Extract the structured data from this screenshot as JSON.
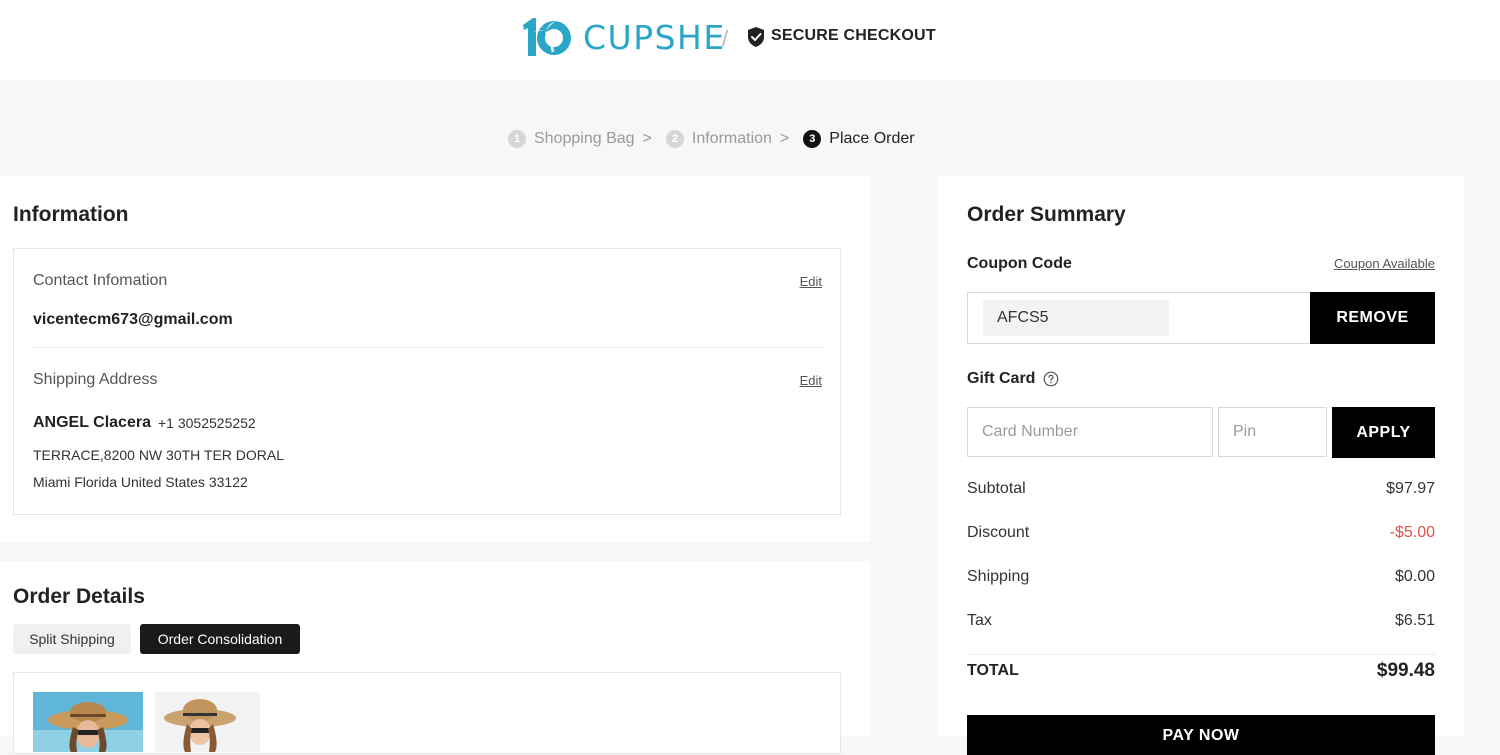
{
  "header": {
    "brand": "CUPSHE",
    "separator": "/",
    "secure_label": "SECURE CHECKOUT"
  },
  "steps": [
    {
      "num": "1",
      "label": "Shopping Bag"
    },
    {
      "num": "2",
      "label": "Information"
    },
    {
      "num": "3",
      "label": "Place Order"
    }
  ],
  "step_separator": ">",
  "information": {
    "title": "Information",
    "contact_label": "Contact Infomation",
    "contact_edit": "Edit",
    "email": "vicentecm673@gmail.com",
    "shipping_label": "Shipping Address",
    "shipping_edit": "Edit",
    "name": "ANGEL Clacera",
    "phone": "+1 3052525252",
    "address_line1": "TERRACE,8200 NW 30TH TER DORAL",
    "address_line2": "Miami Florida United States 33122"
  },
  "order_details": {
    "title": "Order Details",
    "tab_split": "Split Shipping",
    "tab_consolidation": "Order Consolidation"
  },
  "summary": {
    "title": "Order Summary",
    "coupon_label": "Coupon Code",
    "coupon_link": "Coupon Available",
    "coupon_value": "AFCS5",
    "remove_label": "REMOVE",
    "gift_label": "Gift Card",
    "card_placeholder": "Card Number",
    "pin_placeholder": "Pin",
    "apply_label": "APPLY",
    "subtotal_label": "Subtotal",
    "subtotal_value": "$97.97",
    "discount_label": "Discount",
    "discount_value": "-$5.00",
    "shipping_label": "Shipping",
    "shipping_value": "$0.00",
    "tax_label": "Tax",
    "tax_value": "$6.51",
    "total_label": "TOTAL",
    "total_value": "$99.48",
    "pay_label": "PAY NOW"
  },
  "colors": {
    "brand": "#2aa6c9",
    "discount": "#e2544b",
    "button": "#000000"
  }
}
